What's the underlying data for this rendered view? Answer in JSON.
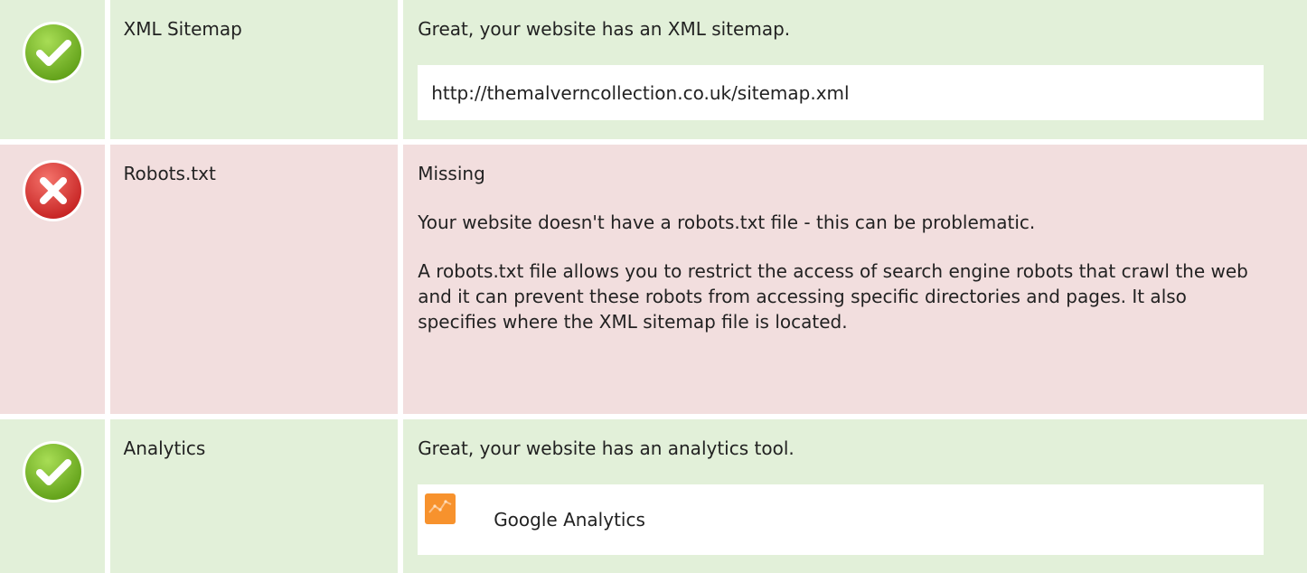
{
  "checks": [
    {
      "status": "pass",
      "status_icon": "check-circle-icon",
      "name": "XML Sitemap",
      "message": "Great, your website has an XML sitemap.",
      "sitemap_url": "http://themalverncollection.co.uk/sitemap.xml"
    },
    {
      "status": "fail",
      "status_icon": "error-x-icon",
      "name": "Robots.txt",
      "message": "Missing",
      "detail_1": "Your website doesn't have a robots.txt file - this can be problematic.",
      "detail_2": "A robots.txt file allows you to restrict the access of search engine robots that crawl the web and it can prevent these robots from accessing specific directories and pages. It also specifies where the XML sitemap file is located."
    },
    {
      "status": "pass",
      "status_icon": "check-circle-icon",
      "name": "Analytics",
      "message": "Great, your website has an analytics tool.",
      "tool_icon": "google-analytics-icon",
      "tool_name": "Google Analytics"
    }
  ],
  "colors": {
    "pass_background": "#e2f0d9",
    "fail_background": "#f2dede",
    "pass_icon": "#7cc02a",
    "fail_icon": "#e0312f",
    "analytics_logo": "#f7922d"
  }
}
